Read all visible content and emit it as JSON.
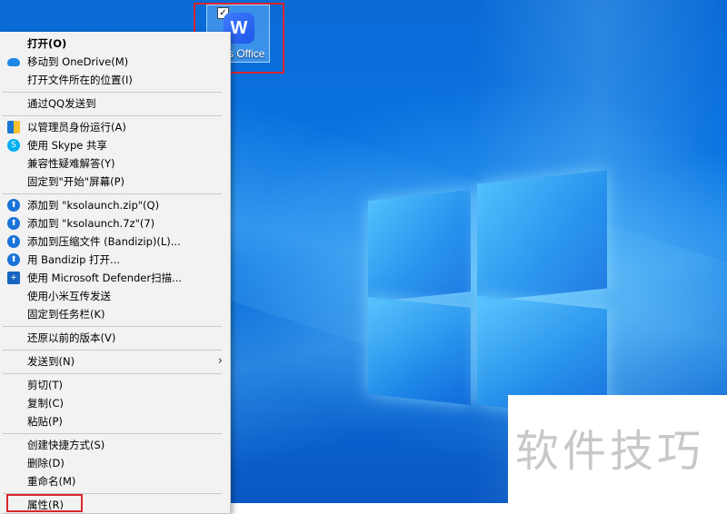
{
  "desktop": {
    "icon": {
      "label": "s Office",
      "logo_letter": "W",
      "checkbox_mark": "✓"
    }
  },
  "menu": {
    "items": [
      {
        "label": "打开(O)"
      },
      {
        "label": "移动到 OneDrive(M)"
      },
      {
        "label": "打开文件所在的位置(I)"
      },
      {
        "label": "通过QQ发送到"
      },
      {
        "label": "以管理员身份运行(A)"
      },
      {
        "label": "使用 Skype 共享"
      },
      {
        "label": "兼容性疑难解答(Y)"
      },
      {
        "label": "固定到\"开始\"屏幕(P)"
      },
      {
        "label": "添加到 \"ksolaunch.zip\"(Q)"
      },
      {
        "label": "添加到 \"ksolaunch.7z\"(7)"
      },
      {
        "label": "添加到压缩文件 (Bandizip)(L)..."
      },
      {
        "label": "用 Bandizip 打开..."
      },
      {
        "label": "使用 Microsoft Defender扫描..."
      },
      {
        "label": "使用小米互传发送"
      },
      {
        "label": "固定到任务栏(K)"
      },
      {
        "label": "还原以前的版本(V)"
      },
      {
        "label": "发送到(N)"
      },
      {
        "label": "剪切(T)"
      },
      {
        "label": "复制(C)"
      },
      {
        "label": "粘贴(P)"
      },
      {
        "label": "创建快捷方式(S)"
      },
      {
        "label": "删除(D)"
      },
      {
        "label": "重命名(M)"
      },
      {
        "label": "属性(R)"
      }
    ],
    "submenu_arrow": "›"
  },
  "watermark": {
    "text": "软件技巧"
  },
  "colors": {
    "highlight_box": "#d9262c",
    "desktop_blue": "#0b78e6"
  },
  "icons": {
    "onedrive": "cloud-icon",
    "shield": "uac-shield-icon",
    "skype": "skype-icon",
    "bandizip": "bandizip-icon",
    "defender": "defender-icon"
  }
}
